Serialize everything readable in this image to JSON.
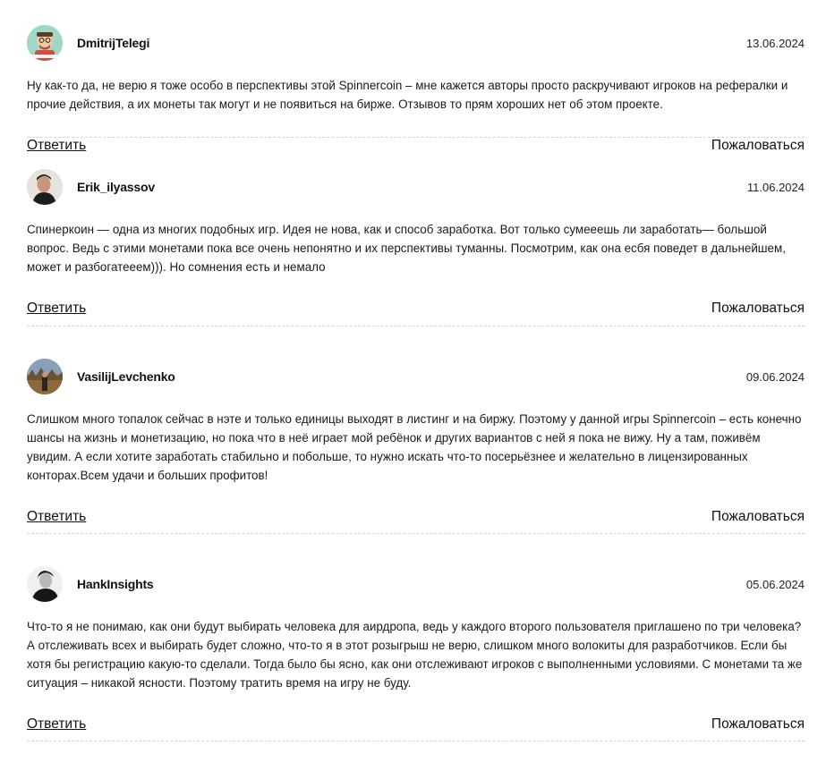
{
  "comments": [
    {
      "author": "DmitrijTelegi",
      "date": "13.06.2024",
      "text": "Ну как-то да, не верю я тоже особо в перспективы этой Spinnercoin – мне кажется авторы просто раскручивают игроков на рефералки и прочие действия, а их монеты так могут и не появиться на бирже. Отзывов то прям хороших нет об этом проекте.",
      "reply_label": "Ответить",
      "report_label": "Пожаловаться"
    },
    {
      "author": "Erik_ilyassov",
      "date": "11.06.2024",
      "text": "Спинеркоин — одна из многих подобных игр. Идея не нова, как и способ заработка. Вот только сумееешь ли заработать— большой вопрос. Ведь с этими монетами пока все очень непонятно и их перспективы туманны. Посмотрим, как она есбя поведет в дальнейшем, может и разбогатееем))). Но сомнения есть и немало",
      "reply_label": "Ответить",
      "report_label": "Пожаловаться"
    },
    {
      "author": "VasilijLevchenko",
      "date": "09.06.2024",
      "text": "Слишком много топалок сейчас в нэте и только единицы выходят в листинг и на биржу. Поэтому у данной игры Spinnercoin – есть конечно шансы на жизнь и монетизацию, но пока что в неё играет мой ребёнок и других вариантов с ней я пока не вижу. Ну а там, поживём увидим. А если хотите заработать стабильно и побольше, то нужно искать что-то посерьёзнее и желательно в лицензированных конторах.Всем удачи и больших профитов!",
      "reply_label": "Ответить",
      "report_label": "Пожаловаться"
    },
    {
      "author": "HankInsights",
      "date": "05.06.2024",
      "text": "Что-то я не понимаю, как они будут выбирать человека для аирдропа, ведь у каждого второго пользователя приглашено по три человека? А отслеживать всех и выбирать будет сложно, что-то я в этот розыгрыш не верю, слишком много волокиты для разработчиков. Если бы хотя бы регистрацию какую-то сделали. Тогда было бы ясно, как они отслеживают игроков с выполненными условиями. С монетами та же ситуация – никакой ясности. Поэтому тратить время на игру не буду.",
      "reply_label": "Ответить",
      "report_label": "Пожаловаться"
    }
  ]
}
